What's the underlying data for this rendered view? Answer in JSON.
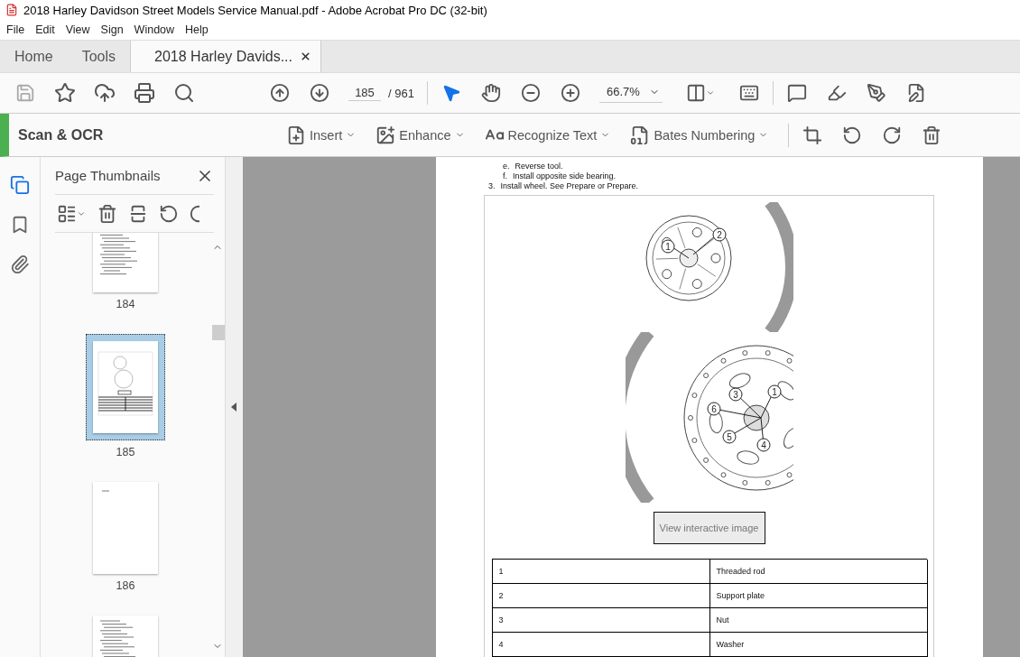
{
  "window": {
    "title": "2018 Harley Davidson Street Models Service Manual.pdf - Adobe Acrobat Pro DC (32-bit)"
  },
  "menu": [
    "File",
    "Edit",
    "View",
    "Sign",
    "Window",
    "Help"
  ],
  "tabs": [
    {
      "label": "Home",
      "selected": false,
      "closable": false
    },
    {
      "label": "Tools",
      "selected": false,
      "closable": false
    },
    {
      "label": "2018 Harley Davids...",
      "selected": true,
      "closable": true
    }
  ],
  "toolbar": {
    "page_current": "185",
    "page_total": "/ 961",
    "zoom": "66.7%",
    "tools": [
      {
        "kind": "select",
        "selected": true
      },
      {
        "kind": "hand",
        "selected": false
      }
    ]
  },
  "tool_panel": {
    "title": "Scan & OCR",
    "tools": [
      {
        "kind": "insert",
        "label": "Insert"
      },
      {
        "kind": "enhance",
        "label": "Enhance"
      },
      {
        "kind": "recognize",
        "label": "Recognize Text"
      },
      {
        "kind": "bates",
        "label": "Bates Numbering"
      }
    ]
  },
  "rail": [
    {
      "kind": "pages",
      "selected": true
    },
    {
      "kind": "bookmarks",
      "selected": false
    },
    {
      "kind": "attachments",
      "selected": false
    }
  ],
  "thumbnails_panel": {
    "title": "Page Thumbnails",
    "pages": [
      {
        "label": "184",
        "selected": false,
        "kind": "text"
      },
      {
        "label": "185",
        "selected": true,
        "kind": "figure"
      },
      {
        "label": "186",
        "selected": false,
        "kind": "blank"
      },
      {
        "selected": false,
        "kind": "text"
      }
    ]
  },
  "document": {
    "steps": [
      {
        "marker": "e.",
        "text": "Reverse tool.",
        "kind": "sub"
      },
      {
        "marker": "f.",
        "text": "Install opposite side bearing.",
        "kind": "sub"
      },
      {
        "marker": "3.",
        "text": "Install wheel. See Prepare or Prepare.",
        "kind": "main"
      }
    ],
    "figure": {
      "top_callouts": [
        "1",
        "2"
      ],
      "bottom_callouts": [
        "1",
        "3",
        "6",
        "5",
        "4"
      ],
      "button": "View interactive image"
    },
    "legend": [
      [
        "1",
        "Threaded rod"
      ],
      [
        "2",
        "Support plate"
      ],
      [
        "3",
        "Nut"
      ],
      [
        "4",
        "Washer"
      ]
    ]
  }
}
